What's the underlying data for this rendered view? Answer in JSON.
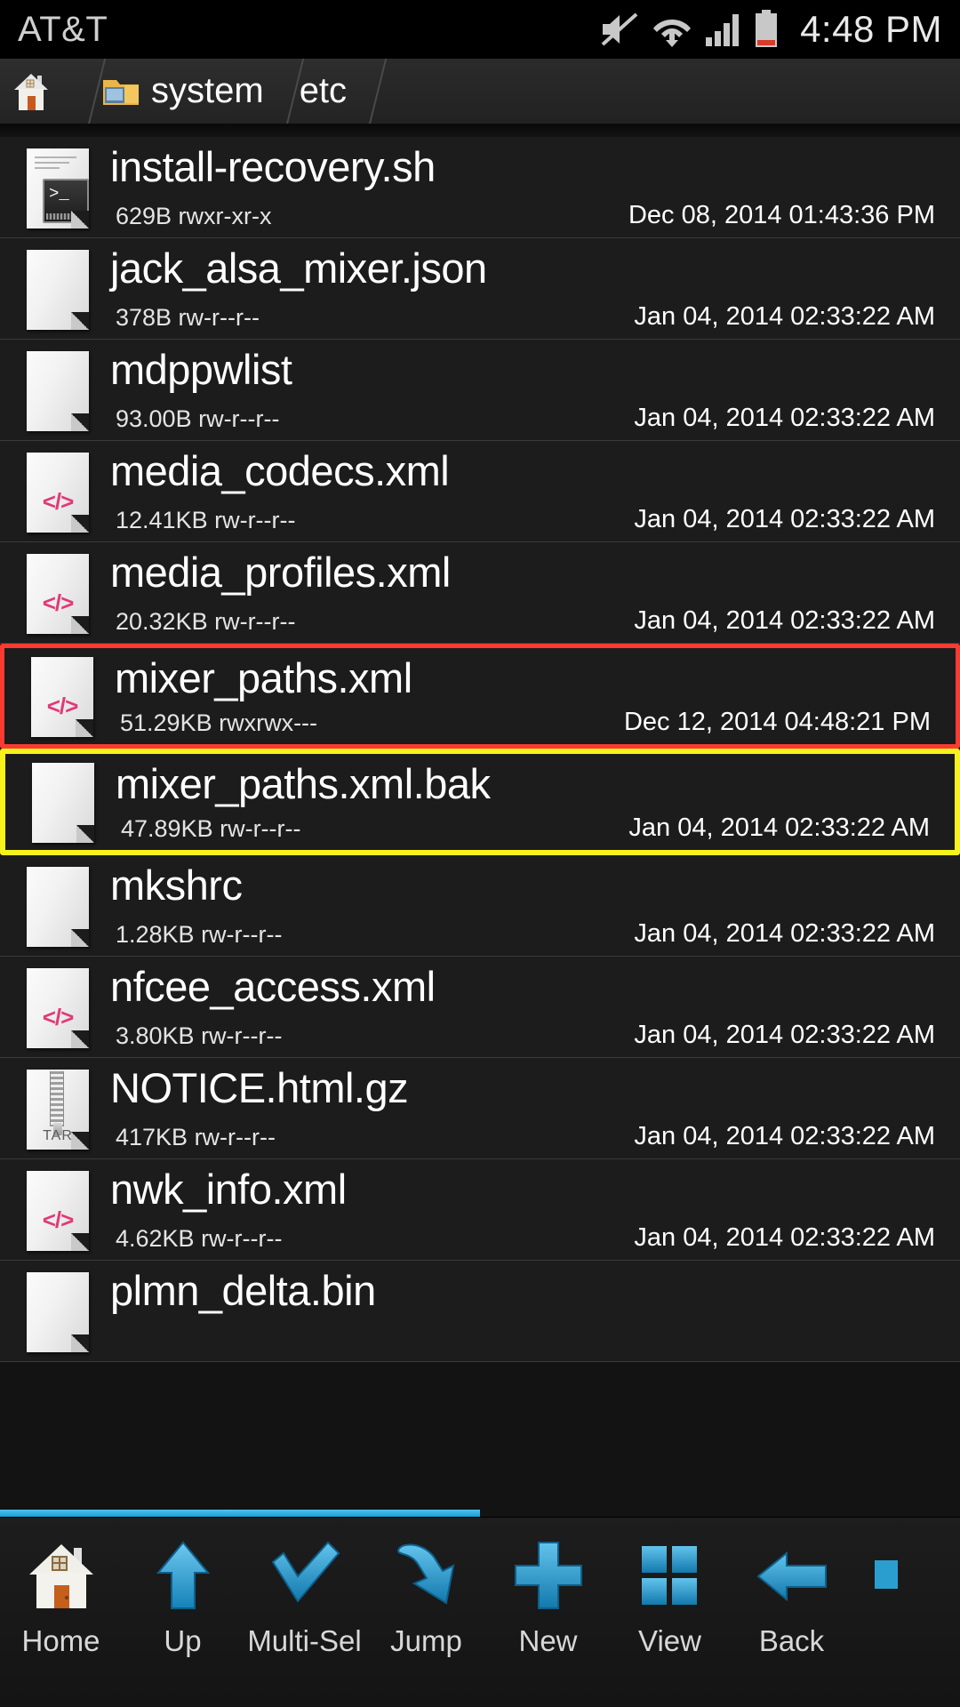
{
  "status_bar": {
    "carrier": "AT&T",
    "time": "4:48 PM",
    "icons": [
      "mute-icon",
      "wifi-icon",
      "cellular-signal-icon",
      "battery-icon"
    ]
  },
  "breadcrumb": {
    "items": [
      {
        "label": "",
        "icon": "home-icon"
      },
      {
        "label": "system",
        "icon": "folder-icon"
      },
      {
        "label": "etc",
        "icon": ""
      }
    ]
  },
  "files": [
    {
      "name": "install-recovery.sh",
      "size": "629B",
      "perms": "rwxr-xr-x",
      "date": "Dec 08, 2014 01:43:36 PM",
      "icon": "script-file-icon",
      "highlight": "none"
    },
    {
      "name": "jack_alsa_mixer.json",
      "size": "378B",
      "perms": "rw-r--r--",
      "date": "Jan 04, 2014 02:33:22 AM",
      "icon": "plain-file-icon",
      "highlight": "none"
    },
    {
      "name": "mdppwlist",
      "size": "93.00B",
      "perms": "rw-r--r--",
      "date": "Jan 04, 2014 02:33:22 AM",
      "icon": "plain-file-icon",
      "highlight": "none"
    },
    {
      "name": "media_codecs.xml",
      "size": "12.41KB",
      "perms": "rw-r--r--",
      "date": "Jan 04, 2014 02:33:22 AM",
      "icon": "xml-file-icon",
      "highlight": "none"
    },
    {
      "name": "media_profiles.xml",
      "size": "20.32KB",
      "perms": "rw-r--r--",
      "date": "Jan 04, 2014 02:33:22 AM",
      "icon": "xml-file-icon",
      "highlight": "none"
    },
    {
      "name": "mixer_paths.xml",
      "size": "51.29KB",
      "perms": "rwxrwx---",
      "date": "Dec 12, 2014 04:48:21 PM",
      "icon": "xml-file-icon",
      "highlight": "red"
    },
    {
      "name": "mixer_paths.xml.bak",
      "size": "47.89KB",
      "perms": "rw-r--r--",
      "date": "Jan 04, 2014 02:33:22 AM",
      "icon": "plain-file-icon",
      "highlight": "yellow"
    },
    {
      "name": "mkshrc",
      "size": "1.28KB",
      "perms": "rw-r--r--",
      "date": "Jan 04, 2014 02:33:22 AM",
      "icon": "plain-file-icon",
      "highlight": "none"
    },
    {
      "name": "nfcee_access.xml",
      "size": "3.80KB",
      "perms": "rw-r--r--",
      "date": "Jan 04, 2014 02:33:22 AM",
      "icon": "xml-file-icon",
      "highlight": "none"
    },
    {
      "name": "NOTICE.html.gz",
      "size": "417KB",
      "perms": "rw-r--r--",
      "date": "Jan 04, 2014 02:33:22 AM",
      "icon": "tar-archive-icon",
      "highlight": "none"
    },
    {
      "name": "nwk_info.xml",
      "size": "4.62KB",
      "perms": "rw-r--r--",
      "date": "Jan 04, 2014 02:33:22 AM",
      "icon": "xml-file-icon",
      "highlight": "none"
    },
    {
      "name": "plmn_delta.bin",
      "size": "",
      "perms": "",
      "date": "",
      "icon": "plain-file-icon",
      "highlight": "none"
    }
  ],
  "toolbar": {
    "buttons": [
      {
        "label": "Home",
        "icon": "home-icon"
      },
      {
        "label": "Up",
        "icon": "up-arrow-icon"
      },
      {
        "label": "Multi-Sel",
        "icon": "checkmark-icon"
      },
      {
        "label": "Jump",
        "icon": "jump-arrow-icon"
      },
      {
        "label": "New",
        "icon": "plus-icon"
      },
      {
        "label": "View",
        "icon": "grid-view-icon"
      },
      {
        "label": "Back",
        "icon": "back-arrow-icon"
      },
      {
        "label": "",
        "icon": "partial-icon"
      }
    ]
  },
  "colors": {
    "accent_blue": "#1a9fd4",
    "highlight_red": "#fb3b30",
    "highlight_yellow": "#f7f21a",
    "xml_code_pink": "#e03a77",
    "row_background": "#1c1c1c"
  }
}
